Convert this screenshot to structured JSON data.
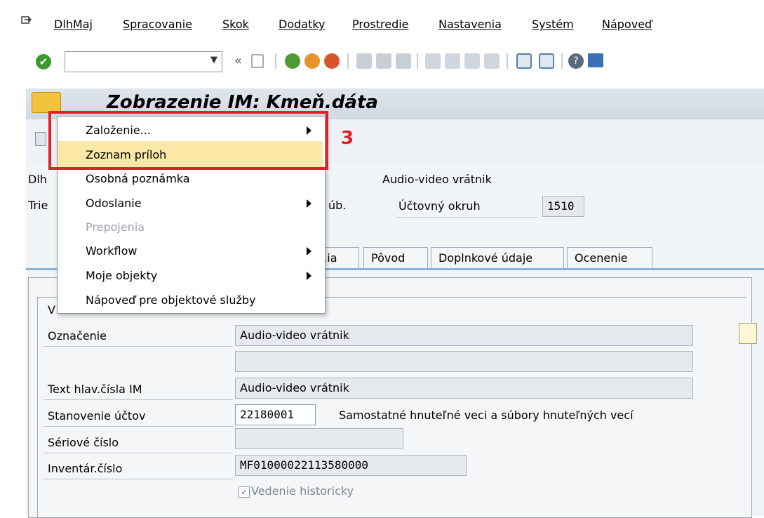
{
  "menubar": {
    "items": [
      "DlhMaj",
      "Spracovanie",
      "Skok",
      "Dodatky",
      "Prostredie",
      "Nastavenia",
      "Systém",
      "Nápoveď"
    ]
  },
  "toolbar": {
    "command_value": "",
    "icons": [
      "enter-check-icon",
      "save-icon",
      "back-icon",
      "exit-icon",
      "cancel-icon",
      "print-icon",
      "find-icon",
      "find-next-icon",
      "first-page-icon",
      "prev-page-icon",
      "next-page-icon",
      "last-page-icon",
      "new-session-icon",
      "shortcut-icon",
      "help-icon",
      "layout-icon"
    ]
  },
  "title": "Zobrazenie IM:  Kmeň.dáta",
  "context_menu": {
    "items": [
      {
        "label": "Založenie...",
        "submenu": true,
        "enabled": true
      },
      {
        "label": "Zoznam príloh",
        "submenu": false,
        "enabled": true,
        "highlighted": true
      },
      {
        "label": "Osobná poznámka",
        "submenu": false,
        "enabled": true
      },
      {
        "label": "Odoslanie",
        "submenu": true,
        "enabled": true
      },
      {
        "label": "Prepojenia",
        "submenu": false,
        "enabled": false
      },
      {
        "label": "Workflow",
        "submenu": true,
        "enabled": true
      },
      {
        "label": "Moje objekty",
        "submenu": true,
        "enabled": true
      },
      {
        "label": "Nápoveď pre objektové služby",
        "submenu": false,
        "enabled": true
      }
    ]
  },
  "annotation_step": "3",
  "header": {
    "label_dlh": "Dlh",
    "label_trie": "Trie",
    "sub_fragment": "úb.",
    "asset_desc": "Audio-video vrátnik",
    "company_label": "Účtovný okruh",
    "company_value": "1510"
  },
  "tabs": [
    "...ia",
    "Pôvod",
    "Doplnkové údaje",
    "Ocenenie"
  ],
  "group_fragment": "V",
  "form": {
    "oznacenie_label": "Označenie",
    "oznacenie_value": "Audio-video vrátnik",
    "oznacenie2_value": "",
    "text_label": "Text hlav.čísla IM",
    "text_value": "Audio-video vrátnik",
    "stanovenie_label": "Stanovenie účtov",
    "stanovenie_value": "22180001",
    "stanovenie_desc": "Samostatné hnuteľné veci a súbory hnuteľných vecí",
    "seriove_label": "Sériové číslo",
    "seriove_value": "",
    "inventar_label": "Inventár.číslo",
    "inventar_value": "MF01000022113580000",
    "vedenie_label": "Vedenie historicky",
    "vedenie_checked": true
  },
  "colors": {
    "highlight": "#fbe8a6",
    "annotation_red": "#e0202a",
    "tab_accent": "#8bb3d7"
  }
}
